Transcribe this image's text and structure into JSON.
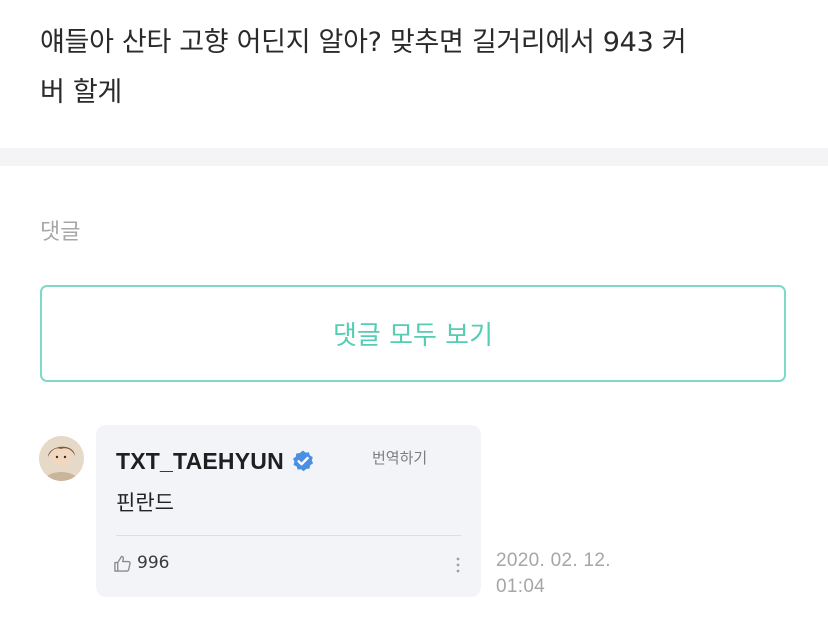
{
  "post": {
    "body_line1": "얘들아 산타 고향 어딘지 알아? 맞추면 길거리에서 943 커",
    "body_line2": "버 할게"
  },
  "comments": {
    "heading": "댓글",
    "view_all_label": "댓글 모두 보기",
    "items": [
      {
        "author": "TXT_TAEHYUN",
        "verified_icon": "verified-badge-icon",
        "translate_label": "번역하기",
        "text": "핀란드",
        "like_icon": "thumbs-up-icon",
        "likes": "996",
        "more_icon": "more-vertical-icon",
        "date": "2020. 02. 12.",
        "time": "01:04"
      }
    ]
  },
  "colors": {
    "accent": "#54cdb2",
    "accent_border": "#7fd9c9",
    "verified": "#4a90e2",
    "bubble_bg": "#f3f4f8",
    "muted_text": "#a6a6a6"
  }
}
